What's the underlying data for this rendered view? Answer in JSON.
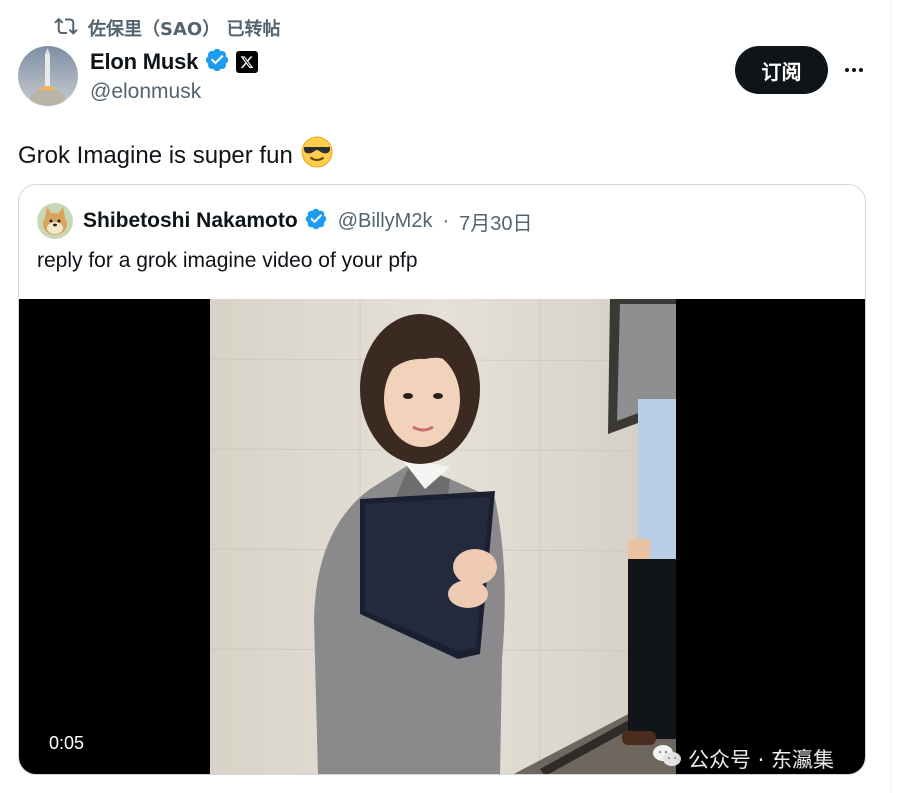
{
  "repost": {
    "icon": "repost-icon",
    "text": "佐保里（SAO） 已转帖"
  },
  "author": {
    "name": "Elon Musk",
    "handle": "@elonmusk",
    "verified_color": "#1d9bf0"
  },
  "actions": {
    "subscribe_label": "订阅",
    "more_icon": "more-icon"
  },
  "tweet": {
    "text": "Grok Imagine is super fun",
    "emoji": "😎"
  },
  "quote": {
    "name": "Shibetoshi Nakamoto",
    "handle": "@BillyM2k",
    "separator": "·",
    "date": "7月30日",
    "text": "reply for a grok imagine video of your pfp",
    "video_time": "0:05"
  },
  "watermark": {
    "text": "公众号 · 东瀛集",
    "icon": "wechat-icon"
  }
}
